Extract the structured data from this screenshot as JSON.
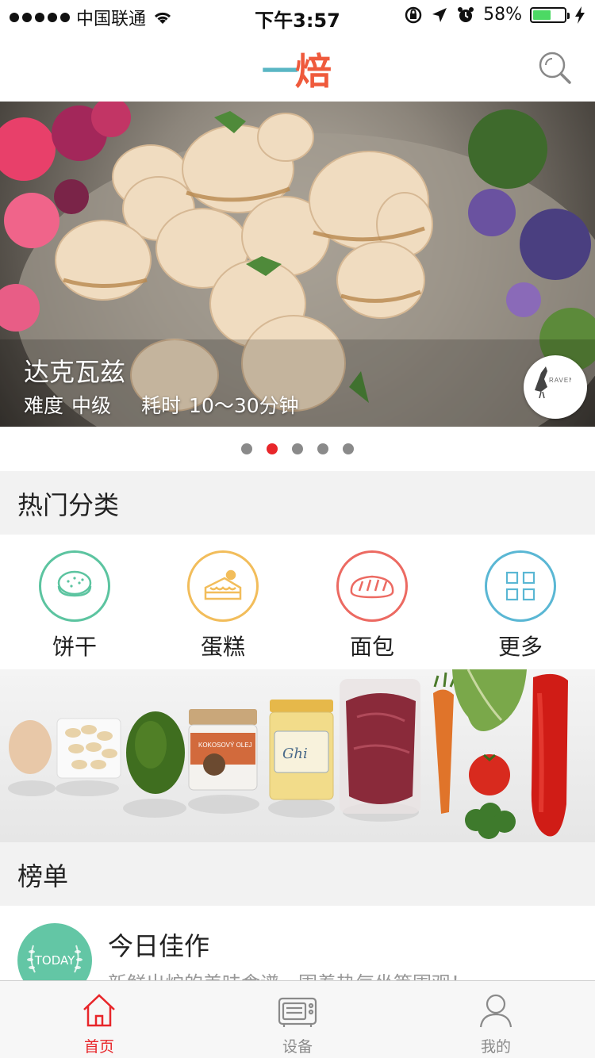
{
  "status_bar": {
    "carrier": "中国联通",
    "time": "下午3:57",
    "battery_percent": "58%",
    "battery_level": 0.58,
    "icons": [
      "signal-dots-icon",
      "wifi-icon",
      "orientation-lock-icon",
      "location-arrow-icon",
      "alarm-icon",
      "battery-icon",
      "charging-bolt-icon"
    ]
  },
  "header": {
    "logo_part1": "一",
    "logo_part2": "焙",
    "search_icon": "search-icon"
  },
  "banner": {
    "title": "达克瓦兹",
    "difficulty_label": "难度",
    "difficulty_value": "中级",
    "time_label": "耗时",
    "time_value": "10～30分钟",
    "author_badge": "RAVEN",
    "page_count": 5,
    "active_page": 2
  },
  "categories": {
    "heading": "热门分类",
    "items": [
      {
        "label": "饼干",
        "icon": "cookie-icon",
        "color": "#5cc4a0"
      },
      {
        "label": "蛋糕",
        "icon": "cake-icon",
        "color": "#f2bd5b"
      },
      {
        "label": "面包",
        "icon": "bread-icon",
        "color": "#ec6a62"
      },
      {
        "label": "更多",
        "icon": "grid-icon",
        "color": "#5ab7d4"
      }
    ]
  },
  "ingredients_image": {
    "jar1_label": "KOKOSOVÝ OLEJ",
    "jar2_label": "Ghi"
  },
  "ranking": {
    "heading": "榜单",
    "items": [
      {
        "badge": "TODAY",
        "title": "今日佳作",
        "subtitle": "新鲜出炉的美味食谱，围着热气坐等围观！"
      }
    ]
  },
  "tab_bar": {
    "tabs": [
      {
        "label": "首页",
        "icon": "home-icon",
        "active": true
      },
      {
        "label": "设备",
        "icon": "oven-icon",
        "active": false
      },
      {
        "label": "我的",
        "icon": "user-icon",
        "active": false
      }
    ]
  },
  "colors": {
    "accent_red": "#e8262a",
    "inactive_gray": "#8a8a8a",
    "section_bg": "#f2f2f2"
  }
}
